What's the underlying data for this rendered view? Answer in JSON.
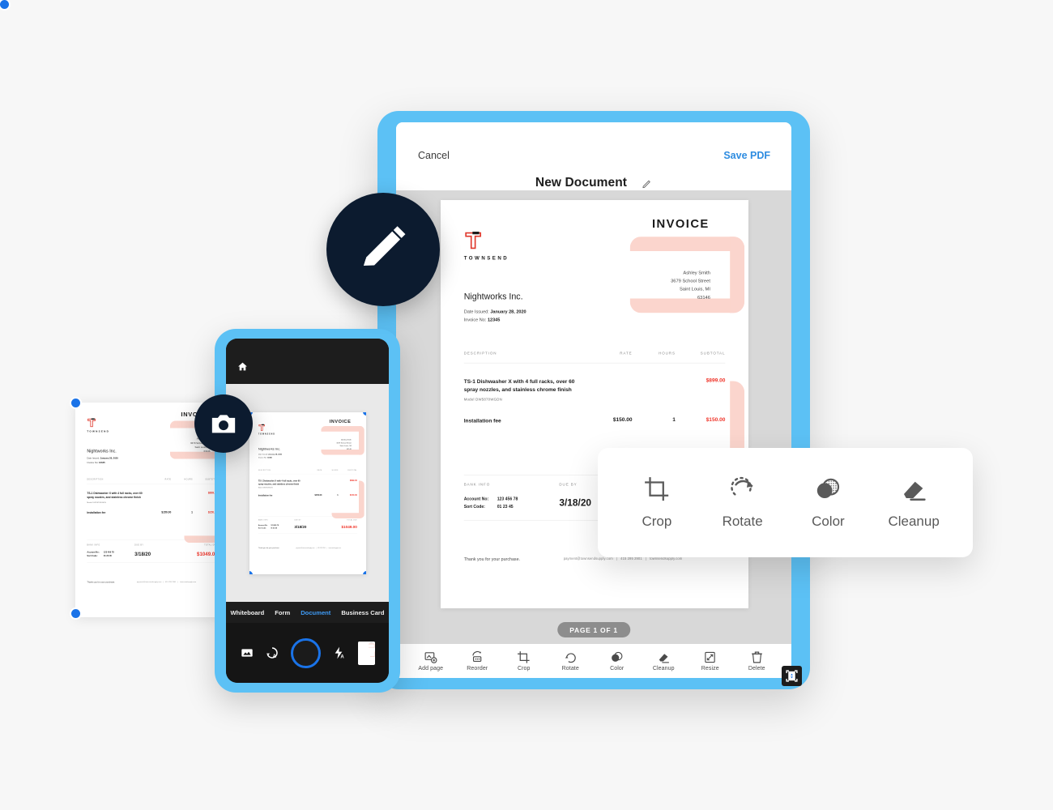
{
  "tablet": {
    "cancel_label": "Cancel",
    "save_label": "Save PDF",
    "document_title": "New Document",
    "page_indicator": "PAGE 1 OF 1",
    "toolbar": [
      {
        "label": "Add page",
        "icon": "add-page-icon"
      },
      {
        "label": "Reorder",
        "icon": "reorder-icon"
      },
      {
        "label": "Crop",
        "icon": "crop-icon"
      },
      {
        "label": "Rotate",
        "icon": "rotate-icon"
      },
      {
        "label": "Color",
        "icon": "color-icon"
      },
      {
        "label": "Cleanup",
        "icon": "cleanup-icon"
      },
      {
        "label": "Resize",
        "icon": "resize-icon"
      },
      {
        "label": "Delete",
        "icon": "delete-icon"
      }
    ]
  },
  "phone": {
    "modes": [
      {
        "label": "Whiteboard",
        "active": false
      },
      {
        "label": "Form",
        "active": false
      },
      {
        "label": "Document",
        "active": true
      },
      {
        "label": "Business Card",
        "active": false
      }
    ],
    "controls": [
      {
        "name": "gallery-icon"
      },
      {
        "name": "auto-capture-icon"
      },
      {
        "name": "shutter-button"
      },
      {
        "name": "flash-auto-icon"
      },
      {
        "name": "last-capture-thumbnail"
      }
    ]
  },
  "float_toolbar": {
    "items": [
      {
        "label": "Crop",
        "icon": "crop-icon"
      },
      {
        "label": "Rotate",
        "icon": "rotate-icon"
      },
      {
        "label": "Color",
        "icon": "color-icon"
      },
      {
        "label": "Cleanup",
        "icon": "cleanup-icon"
      }
    ]
  },
  "badges": {
    "edit": "pencil-icon",
    "capture": "camera-icon"
  },
  "invoice": {
    "brand": "TOWNSEND",
    "title": "INVOICE",
    "client": "Nightworks Inc.",
    "date_label": "Date Issued:",
    "date_value": "January 28, 2020",
    "invoice_label": "Invoice No:",
    "invoice_value": "12345",
    "bill_to": [
      "Ashley Smith",
      "3679  School Street",
      "Saint Louis, MI",
      "63146"
    ],
    "columns": {
      "description": "DESCRIPTION",
      "rate": "RATE",
      "hours": "HOURS",
      "subtotal": "SUBTOTAL"
    },
    "line_items": [
      {
        "description": "TS-1 Dishwasher X with 4 full racks, over 60 spray nozzles, and stainless chrome finish",
        "model": "Model DW5870WGDN",
        "rate": "",
        "hours": "",
        "subtotal": "$899.00"
      },
      {
        "description": "Installation fee",
        "model": "",
        "rate": "$150.00",
        "hours": "1",
        "subtotal": "$150.00"
      }
    ],
    "totals": {
      "bank_label": "BANK INFO",
      "due_label": "DUE BY",
      "total_label": "TOTAL DUE",
      "account_label": "Account No:",
      "account_value": "123 456 78",
      "sort_label": "Sort Code:",
      "sort_value": "01 23 45",
      "due_value": "3/18/20",
      "total_value": "$1049.00"
    },
    "footer": {
      "thanks": "Thank you for your purchase.",
      "email": "payment@townsendsupply.com",
      "phone": "415 295 2901",
      "site": "townsendsupply.com"
    },
    "colors": {
      "accent_red": "#f0352a",
      "accent_pink": "#fbd5cd",
      "brand_blue": "#5cc1f5"
    }
  }
}
